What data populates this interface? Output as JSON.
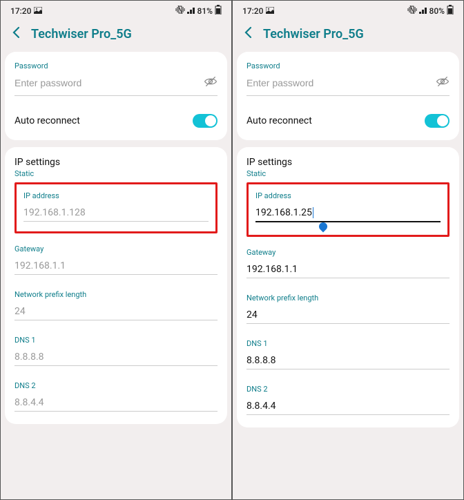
{
  "screens": [
    {
      "status": {
        "time": "17:20",
        "battery": "81%"
      },
      "header": {
        "title": "Techwiser Pro_5G"
      },
      "password": {
        "label": "Password",
        "placeholder": "Enter password",
        "value": ""
      },
      "auto_reconnect": {
        "label": "Auto reconnect",
        "on": true
      },
      "ip_settings": {
        "title": "IP settings",
        "mode": "Static"
      },
      "ip_address": {
        "label": "IP address",
        "value": "192.168.1.128",
        "placeholder": true,
        "focused": false
      },
      "gateway": {
        "label": "Gateway",
        "value": "192.168.1.1",
        "filled": false
      },
      "prefix": {
        "label": "Network prefix length",
        "value": "24",
        "filled": false
      },
      "dns1": {
        "label": "DNS 1",
        "value": "8.8.8.8",
        "filled": false
      },
      "dns2": {
        "label": "DNS 2",
        "value": "8.8.4.4",
        "filled": false
      }
    },
    {
      "status": {
        "time": "17:20",
        "battery": "80%"
      },
      "header": {
        "title": "Techwiser Pro_5G"
      },
      "password": {
        "label": "Password",
        "placeholder": "Enter password",
        "value": ""
      },
      "auto_reconnect": {
        "label": "Auto reconnect",
        "on": true
      },
      "ip_settings": {
        "title": "IP settings",
        "mode": "Static"
      },
      "ip_address": {
        "label": "IP address",
        "value": "192.168.1.25",
        "placeholder": false,
        "focused": true
      },
      "gateway": {
        "label": "Gateway",
        "value": "192.168.1.1",
        "filled": true
      },
      "prefix": {
        "label": "Network prefix length",
        "value": "24",
        "filled": true
      },
      "dns1": {
        "label": "DNS 1",
        "value": "8.8.8.8",
        "filled": true
      },
      "dns2": {
        "label": "DNS 2",
        "value": "8.8.4.4",
        "filled": true
      }
    }
  ]
}
